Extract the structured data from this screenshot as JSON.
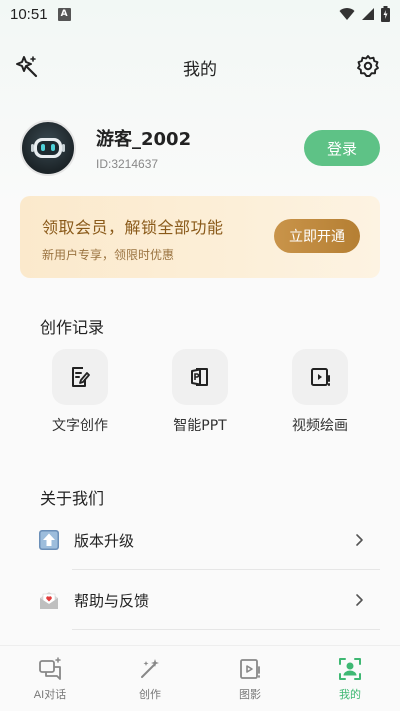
{
  "status_bar": {
    "time": "10:51",
    "notification_icon": "a-icon",
    "wifi_icon": "wifi-icon",
    "signal_icon": "signal-icon",
    "battery_icon": "battery-charging-icon"
  },
  "header": {
    "title": "我的",
    "left_icon": "sparkle-magic-icon",
    "right_icon": "gear-icon"
  },
  "profile": {
    "username": "游客_2002",
    "user_id": "ID:3214637",
    "login_label": "登录",
    "avatar_icon": "robot-avatar-icon"
  },
  "vip_banner": {
    "title": "领取会员，解锁全部功能",
    "subtitle": "新用户专享，领限时优惠",
    "button_label": "立即开通"
  },
  "creation_records": {
    "title": "创作记录",
    "items": [
      {
        "label": "文字创作",
        "icon": "text-edit-icon"
      },
      {
        "label": "智能PPT",
        "icon": "ppt-icon"
      },
      {
        "label": "视频绘画",
        "icon": "video-icon"
      }
    ]
  },
  "about": {
    "title": "关于我们",
    "items": [
      {
        "label": "版本升级",
        "icon": "upload-arrow-icon"
      },
      {
        "label": "帮助与反馈",
        "icon": "envelope-icon"
      }
    ]
  },
  "bottom_nav": {
    "items": [
      {
        "label": "AI对话",
        "icon": "chat-icon",
        "active": false
      },
      {
        "label": "创作",
        "icon": "magic-wand-icon",
        "active": false
      },
      {
        "label": "图影",
        "icon": "video-frame-icon",
        "active": false
      },
      {
        "label": "我的",
        "icon": "profile-icon",
        "active": true
      }
    ]
  },
  "colors": {
    "accent": "#5ec286",
    "vip_text": "#8a5a1a",
    "vip_button": "#b57f33",
    "active_nav": "#3fb873"
  }
}
